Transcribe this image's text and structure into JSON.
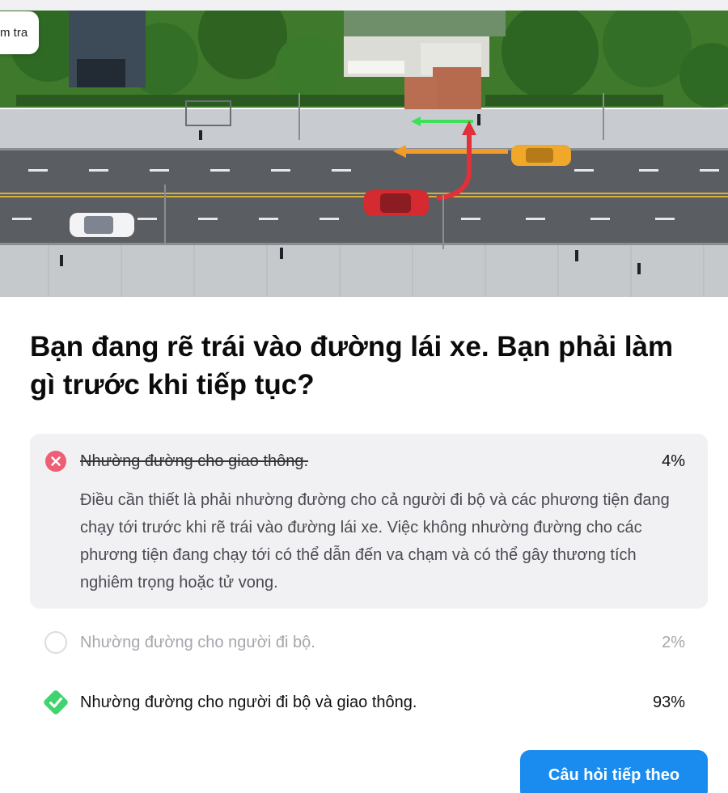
{
  "back_button": {
    "label": "m tra"
  },
  "illustration": {
    "icon": "road-scene-illustration"
  },
  "question": "Bạn đang rẽ trái vào đường lái xe. Bạn phải làm gì trước khi tiếp tục?",
  "options": [
    {
      "label": "Nhường đường cho giao thông.",
      "percent": "4%",
      "state": "wrong",
      "icon": "x-circle-icon"
    },
    {
      "label": "Nhường đường cho người đi bộ.",
      "percent": "2%",
      "state": "unselected",
      "icon": "empty-circle-icon"
    },
    {
      "label": "Nhường đường cho người đi bộ và giao thông.",
      "percent": "93%",
      "state": "correct",
      "icon": "check-diamond-icon"
    }
  ],
  "explanation": "Điều cần thiết là phải nhường đường cho cả người đi bộ và các phương tiện đang chạy tới trước khi rẽ trái vào đường lái xe. Việc không nhường đường cho các phương tiện đang chạy tới có thể dẫn đến va chạm và có thể gây thương tích nghiêm trọng hoặc tử vong.",
  "next_button": {
    "label": "Câu hỏi tiếp theo"
  },
  "colors": {
    "primary": "#1a8cf0",
    "wrong": "#ec5f75",
    "correct": "#3fd46f",
    "card_bg": "#f1f1f4"
  }
}
